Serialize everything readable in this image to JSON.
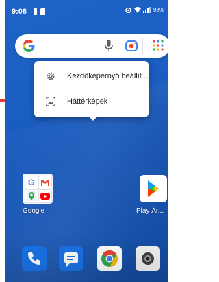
{
  "status_bar": {
    "time": "9:08",
    "battery": "98%"
  },
  "search_bar": {
    "logo": "google-g-icon",
    "icons": [
      "microphone-icon",
      "lens-camera-icon",
      "apps-grid-icon"
    ]
  },
  "context_menu": {
    "items": [
      {
        "label": "Kezdőképernyő beállít...",
        "icon": "gear-icon"
      },
      {
        "label": "Háttérképek",
        "icon": "wallpaper-icon"
      }
    ]
  },
  "home": {
    "folder_label": "Google",
    "play_label": "Play Ár..."
  },
  "dock": {
    "apps": [
      "phone-icon",
      "messages-icon",
      "chrome-icon",
      "camera-icon"
    ]
  },
  "colors": {
    "wallpaper": "#1b5ec2",
    "accent_red": "#e53935"
  }
}
